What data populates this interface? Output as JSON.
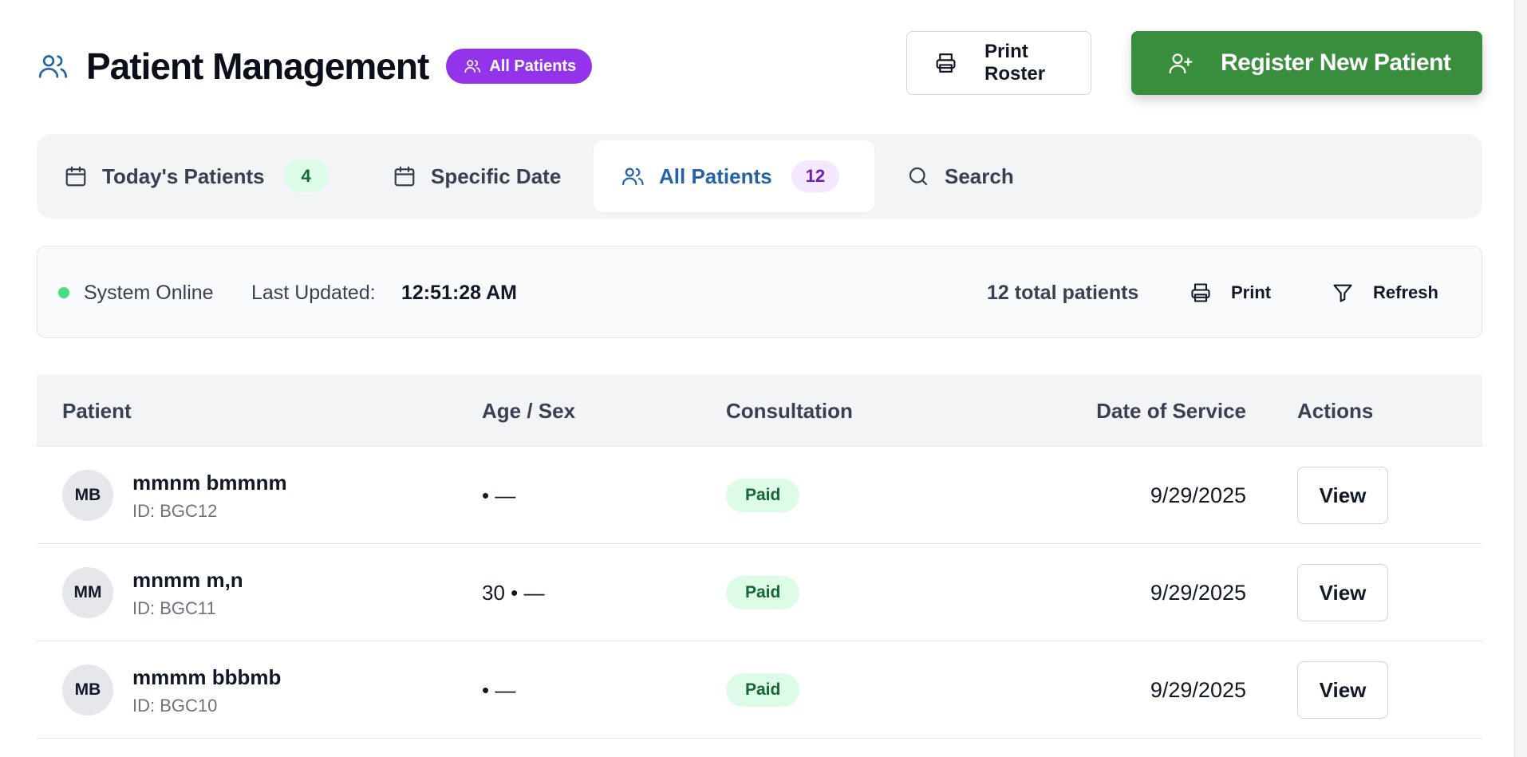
{
  "header": {
    "title": "Patient Management",
    "badge_label": "All Patients",
    "print_roster_label": "Print Roster",
    "register_label": "Register New Patient"
  },
  "tabs": [
    {
      "label": "Today's Patients",
      "count": "4",
      "icon": "calendar-icon"
    },
    {
      "label": "Specific Date",
      "icon": "calendar-icon"
    },
    {
      "label": "All Patients",
      "count": "12",
      "icon": "users-icon",
      "active": true
    },
    {
      "label": "Search",
      "icon": "search-icon"
    }
  ],
  "status": {
    "online_text": "System Online",
    "last_updated_label": "Last Updated:",
    "last_updated_time": "12:51:28 AM",
    "total_patients": "12 total patients",
    "print_label": "Print",
    "refresh_label": "Refresh"
  },
  "table": {
    "columns": [
      "Patient",
      "Age / Sex",
      "Consultation",
      "Date of Service",
      "Actions"
    ],
    "rows": [
      {
        "initials": "MB",
        "name": "mmnm bmmnm",
        "id": "ID: BGC12",
        "age_sex": "• —",
        "consultation": "Paid",
        "date": "9/29/2025",
        "action": "View"
      },
      {
        "initials": "MM",
        "name": "mnmm m,n",
        "id": "ID: BGC11",
        "age_sex": "30 • —",
        "consultation": "Paid",
        "date": "9/29/2025",
        "action": "View"
      },
      {
        "initials": "MB",
        "name": "mmmm bbbmb",
        "id": "ID: BGC10",
        "age_sex": "• —",
        "consultation": "Paid",
        "date": "9/29/2025",
        "action": "View"
      }
    ]
  },
  "colors": {
    "primary_blue": "#2563a6",
    "register_green": "#388e3c",
    "badge_purple": "#9333ea",
    "online_green": "#4ade80"
  }
}
